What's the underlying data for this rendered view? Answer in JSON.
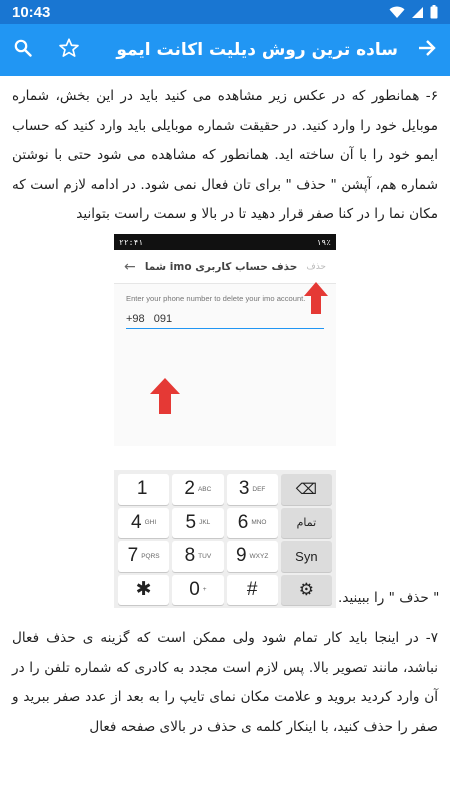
{
  "status_bar": {
    "time": "10:43"
  },
  "app_bar": {
    "title": "ساده ترین روش دیلیت اکانت ایمو"
  },
  "article": {
    "paragraph_1": "۶- همانطور که در عکس زیر مشاهده می کنید باید در این بخش، شماره موبایل خود را وارد کنید. در حقیقت شماره موبایلی باید وارد کنید که حساب ایمو خود را با آن ساخته اید. همانطور که مشاهده می شود حتی با نوشتن شماره هم، آپشن \" حذف \" برای تان فعال نمی شود. در ادامه لازم است که مکان نما را در کنا صفر قرار دهید تا در بالا و سمت راست بتوانید",
    "paragraph_1_end": "\" حذف \" را ببینید.",
    "paragraph_2": "۷- در اینجا باید کار تمام شود ولی ممکن است که گزینه ی حذف فعال نباشد، مانند تصویر بالا. پس لازم است مجدد به کادری که شماره تلفن را در آن وارد کردید بروید و علامت مکان نمای تایپ را به بعد از عدد صفر ببرید و صفر را حذف کنید، با اینکار کلمه ی حذف در بالای صفحه فعال"
  },
  "screenshot_1": {
    "status_time": "۲۲:۴۱",
    "status_battery": "۱۹٪",
    "header_title": "حذف حساب کاربری imo شما",
    "delete_label": "حذف",
    "hint": "Enter your phone number to delete your imo account.",
    "country_code": "+98",
    "phone_value": "091"
  },
  "keypad": {
    "keys": [
      {
        "d": "1",
        "s": ""
      },
      {
        "d": "2",
        "s": "ABC"
      },
      {
        "d": "3",
        "s": "DEF"
      },
      {
        "d": "⌫",
        "s": ""
      },
      {
        "d": "4",
        "s": "GHI"
      },
      {
        "d": "5",
        "s": "JKL"
      },
      {
        "d": "6",
        "s": "MNO"
      },
      {
        "d": "تمام",
        "s": ""
      },
      {
        "d": "7",
        "s": "PQRS"
      },
      {
        "d": "8",
        "s": "TUV"
      },
      {
        "d": "9",
        "s": "WXYZ"
      },
      {
        "d": "Syn",
        "s": ""
      },
      {
        "d": "✱",
        "s": ""
      },
      {
        "d": "0",
        "s": "+"
      },
      {
        "d": "#",
        "s": ""
      },
      {
        "d": "⚙",
        "s": ""
      }
    ]
  },
  "colors": {
    "status_bar": "#1976d2",
    "app_bar": "#2196f3",
    "arrow": "#e53935"
  },
  "icons": [
    "wifi-icon",
    "signal-icon",
    "battery-icon",
    "back-arrow-icon",
    "star-icon",
    "search-icon"
  ]
}
